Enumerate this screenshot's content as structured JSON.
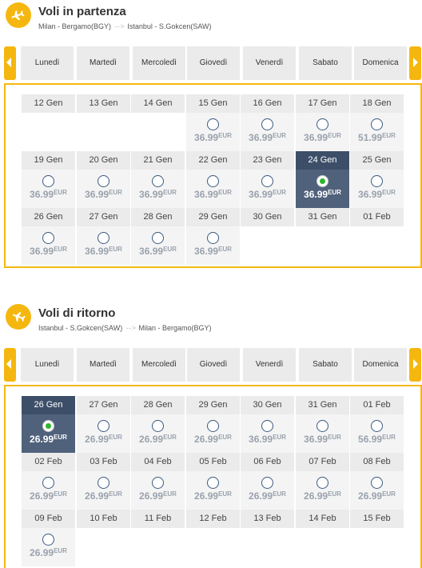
{
  "outbound": {
    "title": "Voli in partenza",
    "route_from": "Milan - Bergamo(BGY)",
    "route_arrow": "- - >",
    "route_to": "Istanbul - S.Gokcen(SAW)",
    "days": [
      "Lunedì",
      "Martedì",
      "Mercoledì",
      "Giovedì",
      "Venerdì",
      "Sabato",
      "Domenica"
    ],
    "rows": [
      [
        {
          "date": "12 Gen"
        },
        {
          "date": "13 Gen"
        },
        {
          "date": "14 Gen"
        },
        {
          "date": "15 Gen",
          "price": "36.99",
          "currency": "EUR"
        },
        {
          "date": "16 Gen",
          "price": "36.99",
          "currency": "EUR"
        },
        {
          "date": "17 Gen",
          "price": "36.99",
          "currency": "EUR"
        },
        {
          "date": "18 Gen",
          "price": "51.99",
          "currency": "EUR"
        }
      ],
      [
        {
          "date": "19 Gen",
          "price": "36.99",
          "currency": "EUR"
        },
        {
          "date": "20 Gen",
          "price": "36.99",
          "currency": "EUR"
        },
        {
          "date": "21 Gen",
          "price": "36.99",
          "currency": "EUR"
        },
        {
          "date": "22 Gen",
          "price": "36.99",
          "currency": "EUR"
        },
        {
          "date": "23 Gen",
          "price": "36.99",
          "currency": "EUR"
        },
        {
          "date": "24 Gen",
          "price": "36.99",
          "currency": "EUR",
          "selected": true
        },
        {
          "date": "25 Gen",
          "price": "36.99",
          "currency": "EUR"
        }
      ],
      [
        {
          "date": "26 Gen",
          "price": "36.99",
          "currency": "EUR"
        },
        {
          "date": "27 Gen",
          "price": "36.99",
          "currency": "EUR"
        },
        {
          "date": "28 Gen",
          "price": "36.99",
          "currency": "EUR"
        },
        {
          "date": "29 Gen",
          "price": "36.99",
          "currency": "EUR"
        },
        {
          "date": "30 Gen"
        },
        {
          "date": "31 Gen"
        },
        {
          "date": "01 Feb"
        }
      ]
    ]
  },
  "return": {
    "title": "Voli di ritorno",
    "route_from": "Istanbul - S.Gokcen(SAW)",
    "route_arrow": "- - >",
    "route_to": "Milan - Bergamo(BGY)",
    "days": [
      "Lunedì",
      "Martedì",
      "Mercoledì",
      "Giovedì",
      "Venerdì",
      "Sabato",
      "Domenica"
    ],
    "rows": [
      [
        {
          "date": "26 Gen",
          "price": "26.99",
          "currency": "EUR",
          "selected": true
        },
        {
          "date": "27 Gen",
          "price": "26.99",
          "currency": "EUR"
        },
        {
          "date": "28 Gen",
          "price": "26.99",
          "currency": "EUR"
        },
        {
          "date": "29 Gen",
          "price": "26.99",
          "currency": "EUR"
        },
        {
          "date": "30 Gen",
          "price": "36.99",
          "currency": "EUR"
        },
        {
          "date": "31 Gen",
          "price": "36.99",
          "currency": "EUR"
        },
        {
          "date": "01 Feb",
          "price": "56.99",
          "currency": "EUR"
        }
      ],
      [
        {
          "date": "02 Feb",
          "price": "26.99",
          "currency": "EUR"
        },
        {
          "date": "03 Feb",
          "price": "26.99",
          "currency": "EUR"
        },
        {
          "date": "04 Feb",
          "price": "26.99",
          "currency": "EUR"
        },
        {
          "date": "05 Feb",
          "price": "26.99",
          "currency": "EUR"
        },
        {
          "date": "06 Feb",
          "price": "26.99",
          "currency": "EUR"
        },
        {
          "date": "07 Feb",
          "price": "26.99",
          "currency": "EUR"
        },
        {
          "date": "08 Feb",
          "price": "26.99",
          "currency": "EUR"
        }
      ],
      [
        {
          "date": "09 Feb",
          "price": "26.99",
          "currency": "EUR"
        },
        {
          "date": "10 Feb"
        },
        {
          "date": "11 Feb"
        },
        {
          "date": "12 Feb"
        },
        {
          "date": "13 Feb"
        },
        {
          "date": "14 Feb"
        },
        {
          "date": "15 Feb"
        }
      ]
    ]
  },
  "colors": {
    "accent": "#f5b70f",
    "selected": "#50617b",
    "radio_selected": "#2db52d"
  },
  "icons": {
    "header": "plane-icon",
    "prev": "chevron-left-icon",
    "next": "chevron-right-icon"
  }
}
